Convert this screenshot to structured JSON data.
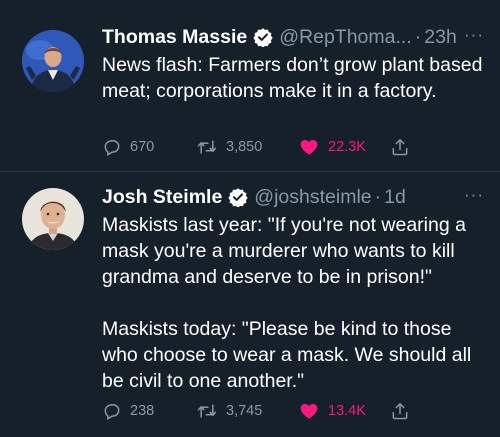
{
  "colors": {
    "background": "#15202b",
    "text": "#ffffff",
    "secondary": "#8899a6",
    "like": "#f91880",
    "verified": "#1d9bf0"
  },
  "tweets": [
    {
      "display_name": "Thomas Massie",
      "handle": "@RepThoma...",
      "separator": "·",
      "time": "23h",
      "more": "···",
      "text": "News flash: Farmers don’t grow plant based meat; corporations make it in a factory.",
      "replies": "670",
      "retweets": "3,850",
      "likes": "22.3K",
      "liked": true,
      "icons": [
        "verified-badge-icon",
        "reply-icon",
        "retweet-icon",
        "heart-icon",
        "share-icon"
      ]
    },
    {
      "display_name": "Josh Steimle",
      "handle": "@joshsteimle",
      "separator": "·",
      "time": "1d",
      "more": "···",
      "text": "Maskists last year: \"If you're not wearing a mask you're a murderer who wants to kill grandma and deserve to be in prison!\"\n\nMaskists today: \"Please be kind to those who choose to wear a mask. We should all be civil to one another.\"",
      "replies": "238",
      "retweets": "3,745",
      "likes": "13.4K",
      "liked": true,
      "icons": [
        "verified-badge-icon",
        "reply-icon",
        "retweet-icon",
        "heart-icon",
        "share-icon"
      ]
    }
  ]
}
